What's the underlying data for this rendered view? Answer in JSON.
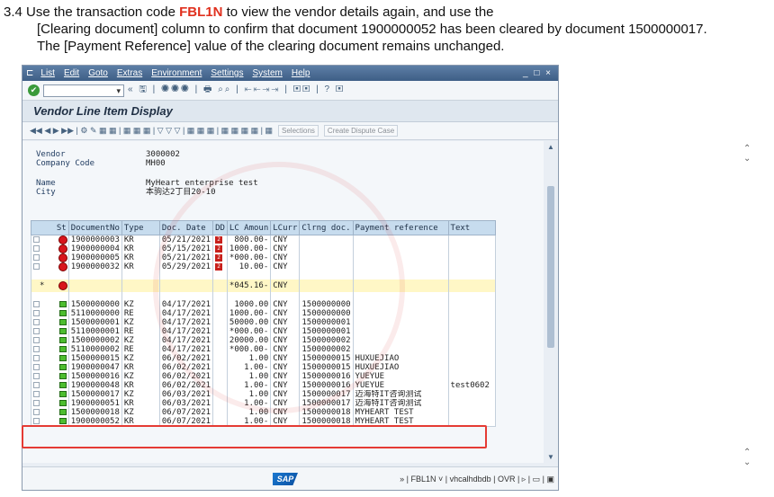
{
  "instruction": {
    "prefix": "3.4 Use the transaction code ",
    "code": "FBL1N",
    "line1_rest": " to view the vendor details again, and use the",
    "line2": "[Clearing document] column to confirm that document 1900000052 has been cleared by document 1500000017.",
    "line3": "The [Payment Reference] value of the clearing document remains unchanged."
  },
  "menu": [
    "List",
    "Edit",
    "Goto",
    "Extras",
    "Environment",
    "Settings",
    "System",
    "Help"
  ],
  "window_controls": "_ □ ×",
  "toolbar": {
    "command_field": "",
    "icons": "« 🖫 | ◉◉◉ | 🖶 ⌕⌕ | ⇤⇤⇥⇥ | ▣▣ | ? ▣"
  },
  "title": "Vendor Line Item Display",
  "app_toolbar": {
    "icons": "◀◀ ◀ ▶ ▶▶ | ⚙ ✎ ▦ ▦ | ▦ ▦ ▦ | ▽ ▽ ▽ | ▦ ▦ ▦ | ▦ ▦ ▦ ▦ | ▦",
    "selections": "Selections",
    "create_dispute": "Create Dispute Case"
  },
  "header": {
    "vendor_label": "Vendor",
    "vendor_value": "3000002",
    "company_label": "Company Code",
    "company_value": "MH00",
    "name_label": "Name",
    "name_value": "MyHeart enterprise test",
    "city_label": "City",
    "city_value": "本驹达2丁目20-10"
  },
  "columns": [
    "St",
    "DocumentNo",
    "Type",
    "Doc. Date",
    "DD",
    "LC Amoun",
    "LCurr",
    "Clrng doc.",
    "Payment reference",
    "Text"
  ],
  "open_items": [
    {
      "doc": "1900000003",
      "type": "KR",
      "date": "05/21/2021",
      "amount": "800.00-",
      "curr": "CNY"
    },
    {
      "doc": "1900000004",
      "type": "KR",
      "date": "05/15/2021",
      "amount": "1000.00-",
      "curr": "CNY"
    },
    {
      "doc": "1900000005",
      "type": "KR",
      "date": "05/21/2021",
      "amount": "*000.00-",
      "curr": "CNY"
    },
    {
      "doc": "1900000032",
      "type": "KR",
      "date": "05/29/2021",
      "amount": "10.00-",
      "curr": "CNY"
    }
  ],
  "open_total": {
    "marker": "*",
    "amount": "*045.16-",
    "curr": "CNY"
  },
  "cleared_items": [
    {
      "doc": "1500000000",
      "type": "KZ",
      "date": "04/17/2021",
      "amount": "1000.00",
      "curr": "CNY",
      "clr": "1500000000",
      "ref": "",
      "text": ""
    },
    {
      "doc": "5110000000",
      "type": "RE",
      "date": "04/17/2021",
      "amount": "1000.00-",
      "curr": "CNY",
      "clr": "1500000000",
      "ref": "",
      "text": ""
    },
    {
      "doc": "1500000001",
      "type": "KZ",
      "date": "04/17/2021",
      "amount": "50000.00",
      "curr": "CNY",
      "clr": "1500000001",
      "ref": "",
      "text": ""
    },
    {
      "doc": "5110000001",
      "type": "RE",
      "date": "04/17/2021",
      "amount": "*000.00-",
      "curr": "CNY",
      "clr": "1500000001",
      "ref": "",
      "text": ""
    },
    {
      "doc": "1500000002",
      "type": "KZ",
      "date": "04/17/2021",
      "amount": "20000.00",
      "curr": "CNY",
      "clr": "1500000002",
      "ref": "",
      "text": ""
    },
    {
      "doc": "5110000002",
      "type": "RE",
      "date": "04/17/2021",
      "amount": "*000.00-",
      "curr": "CNY",
      "clr": "1500000002",
      "ref": "",
      "text": ""
    },
    {
      "doc": "1500000015",
      "type": "KZ",
      "date": "06/02/2021",
      "amount": "1.00",
      "curr": "CNY",
      "clr": "1500000015",
      "ref": "HUXUEJIAO",
      "text": ""
    },
    {
      "doc": "1900000047",
      "type": "KR",
      "date": "06/02/2021",
      "amount": "1.00-",
      "curr": "CNY",
      "clr": "1500000015",
      "ref": "HUXUEJIAO",
      "text": ""
    },
    {
      "doc": "1500000016",
      "type": "KZ",
      "date": "06/02/2021",
      "amount": "1.00",
      "curr": "CNY",
      "clr": "1500000016",
      "ref": "YUEYUE",
      "text": ""
    },
    {
      "doc": "1900000048",
      "type": "KR",
      "date": "06/02/2021",
      "amount": "1.00-",
      "curr": "CNY",
      "clr": "1500000016",
      "ref": "YUEYUE",
      "text": "test0602"
    },
    {
      "doc": "1500000017",
      "type": "KZ",
      "date": "06/03/2021",
      "amount": "1.00",
      "curr": "CNY",
      "clr": "1500000017",
      "ref": "迈海特IT咨询测试",
      "text": ""
    },
    {
      "doc": "1900000051",
      "type": "KR",
      "date": "06/03/2021",
      "amount": "1.00-",
      "curr": "CNY",
      "clr": "1500000017",
      "ref": "迈海特IT咨询测试",
      "text": ""
    },
    {
      "doc": "1500000018",
      "type": "KZ",
      "date": "06/07/2021",
      "amount": "1.00",
      "curr": "CNY",
      "clr": "1500000018",
      "ref": "MYHEART TEST",
      "text": ""
    },
    {
      "doc": "1900000052",
      "type": "KR",
      "date": "06/07/2021",
      "amount": "1.00-",
      "curr": "CNY",
      "clr": "1500000018",
      "ref": "MYHEART TEST",
      "text": ""
    }
  ],
  "dd_badge": "2",
  "status_bar": {
    "logo": "SAP",
    "info": "» | FBL1N ˅ | vhcalhdbdb | OVR | ▹ | ▭ | ▣"
  },
  "colors": {
    "highlight": "#e53b34",
    "code": "#e0301e",
    "header_bg": "#c7dcee",
    "total_bg": "#fff7c6"
  }
}
